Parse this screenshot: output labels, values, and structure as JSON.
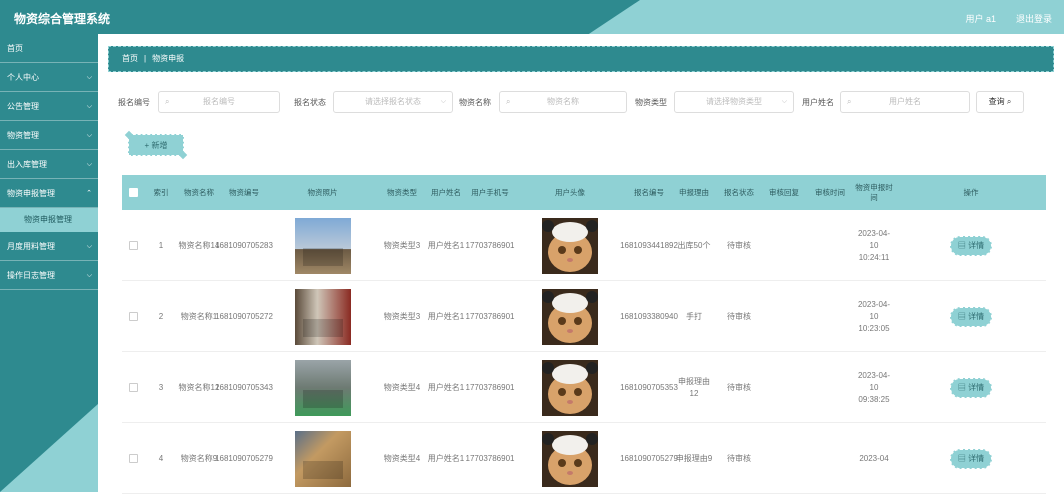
{
  "header": {
    "title": "物资综合管理系统",
    "user": "用户 a1",
    "logout": "退出登录"
  },
  "sidebar": {
    "items": [
      {
        "label": "首页",
        "chevron": false
      },
      {
        "label": "个人中心",
        "chevron": true
      },
      {
        "label": "公告管理",
        "chevron": true
      },
      {
        "label": "物资管理",
        "chevron": true
      },
      {
        "label": "出入库管理",
        "chevron": true
      },
      {
        "label": "物资申报管理",
        "chevron": true,
        "sub": "物资申报管理"
      },
      {
        "label": "月度用料管理",
        "chevron": true
      },
      {
        "label": "操作日志管理",
        "chevron": true
      }
    ]
  },
  "breadcrumb": {
    "home": "首页",
    "sep": "|",
    "current": "物资申报"
  },
  "filters": {
    "report_no_label": "报名编号",
    "report_no_placeholder": "报名编号",
    "status_label": "报名状态",
    "status_placeholder": "请选择报名状态",
    "name_label": "物资名称",
    "name_placeholder": "物资名称",
    "type_label": "物资类型",
    "type_placeholder": "请选择物资类型",
    "user_label": "用户姓名",
    "user_placeholder": "用户姓名",
    "search_label": "查询"
  },
  "add_label": "+ 新增",
  "table": {
    "headers": {
      "index": "索引",
      "name": "物资名称",
      "code": "物资编号",
      "photo": "物资照片",
      "type": "物资类型",
      "uname": "用户姓名",
      "phone": "用户手机号",
      "avatar": "用户头像",
      "regno": "报名编号",
      "reason": "申报理由",
      "status": "报名状态",
      "reply": "审核回复",
      "audit_time": "审核时间",
      "time": "物资申报时间",
      "ops": "操作"
    },
    "rows": [
      {
        "index": "1",
        "name": "物资名称14",
        "code": "1681090705283",
        "type": "物资类型3",
        "uname": "用户姓名1",
        "phone": "17703786901",
        "regno": "1681093441892",
        "reason": "出库50个",
        "status": "待审核",
        "reply": "",
        "audit_time": "",
        "time": "2023-04-10 10:24:11",
        "detail": "详情"
      },
      {
        "index": "2",
        "name": "物资名称1",
        "code": "1681090705272",
        "type": "物资类型3",
        "uname": "用户姓名1",
        "phone": "17703786901",
        "regno": "1681093380940",
        "reason": "手打",
        "status": "待审核",
        "reply": "",
        "audit_time": "",
        "time": "2023-04-10 10:23:05",
        "detail": "详情"
      },
      {
        "index": "3",
        "name": "物资名称12",
        "code": "1681090705343",
        "type": "物资类型4",
        "uname": "用户姓名1",
        "phone": "17703786901",
        "regno": "1681090705353",
        "reason": "申报理由12",
        "status": "待审核",
        "reply": "",
        "audit_time": "",
        "time": "2023-04-10 09:38:25",
        "detail": "详情"
      },
      {
        "index": "4",
        "name": "物资名称9",
        "code": "1681090705279",
        "type": "物资类型4",
        "uname": "用户姓名1",
        "phone": "17703786901",
        "regno": "1681090705279",
        "reason": "申报理由9",
        "status": "待审核",
        "reply": "",
        "audit_time": "",
        "time": "2023-04",
        "detail": "详情"
      }
    ]
  },
  "colors": {
    "dark": "#2e8a8f",
    "light": "#8fd1d4"
  }
}
